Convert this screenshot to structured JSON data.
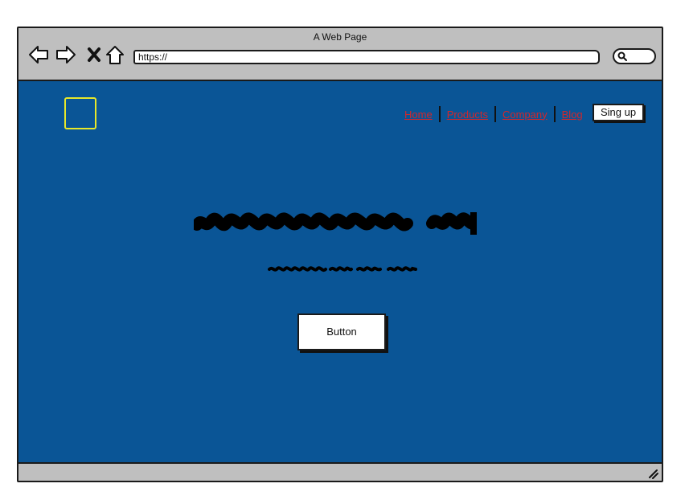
{
  "window": {
    "title": "A Web Page"
  },
  "toolbar": {
    "icons": [
      "back-arrow-icon",
      "forward-arrow-icon",
      "stop-icon",
      "home-icon",
      "search-icon"
    ],
    "url": "https://"
  },
  "site": {
    "nav": {
      "links": [
        "Home",
        "Products",
        "Company",
        "Blog"
      ],
      "signup_label": "Sing up"
    },
    "hero": {
      "button_label": "Button"
    }
  },
  "colors": {
    "page_background": "#0a5596",
    "chrome": "#bfbfbf",
    "link": "#d2272b",
    "logo_border": "#e8e82a"
  }
}
